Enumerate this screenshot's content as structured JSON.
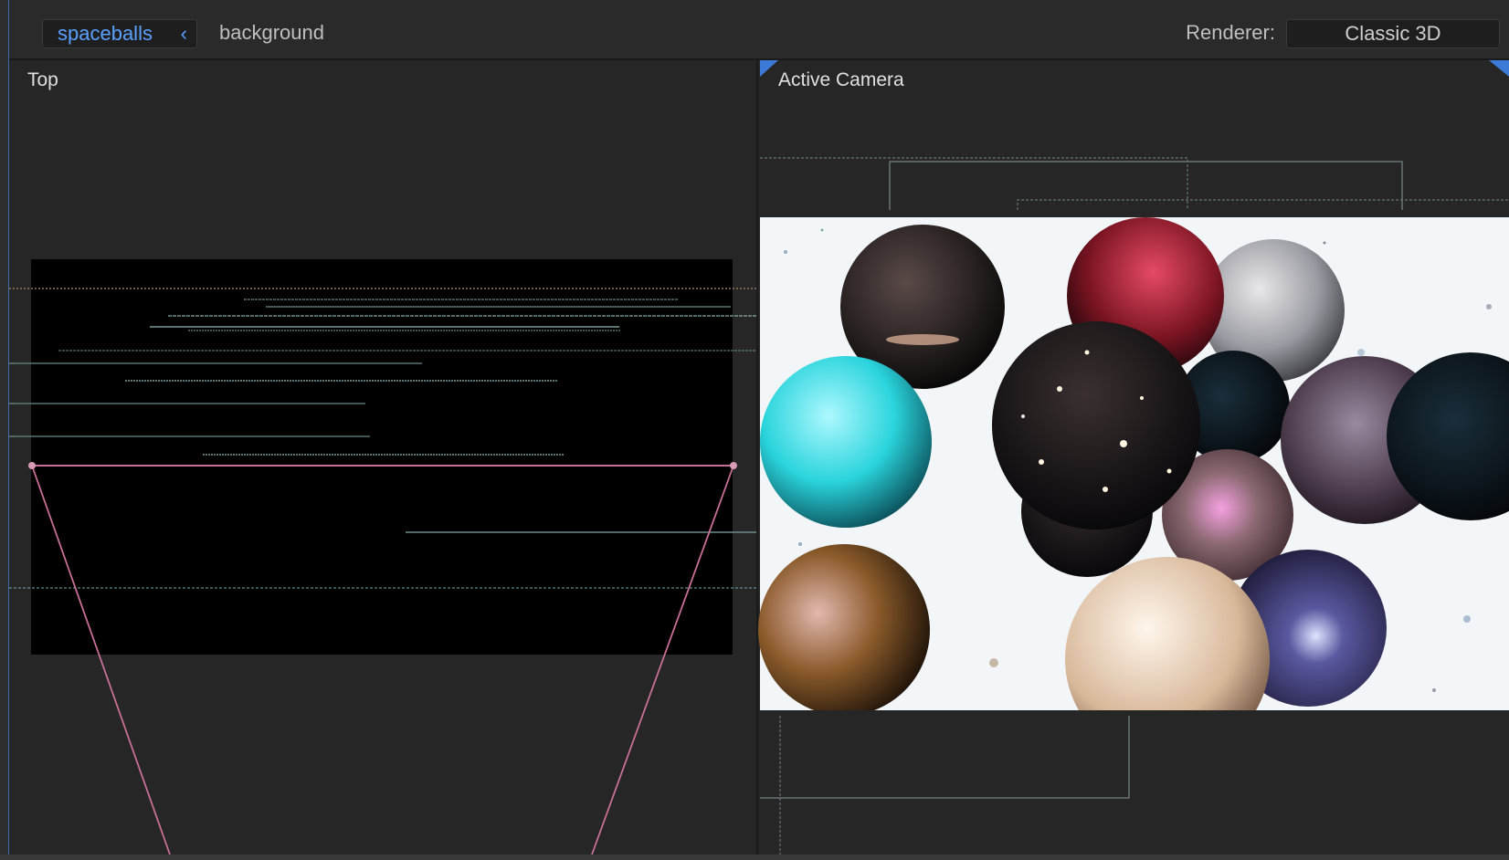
{
  "breadcrumb": {
    "active": "spaceballs",
    "next": "background"
  },
  "renderer": {
    "label": "Renderer:",
    "value": "Classic 3D"
  },
  "viewports": {
    "left_title": "Top",
    "right_title": "Active Camera"
  },
  "icons": {
    "back": "chevron-left-icon",
    "corner": "corner-handle-icon"
  },
  "colors": {
    "accent": "#5aa0ff",
    "frustum": "#c86f96",
    "background": "#262626",
    "scene_bg": "#f2f6f8"
  }
}
